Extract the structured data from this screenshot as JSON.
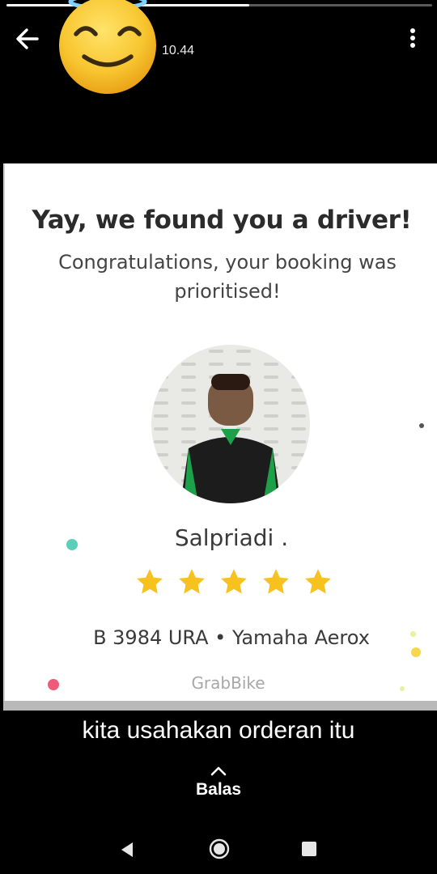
{
  "status": {
    "progress": 0.57,
    "timestamp": "10.44"
  },
  "header": {
    "back_icon": "arrow-left-icon",
    "avatar": "smiling-face-with-halo-emoji",
    "menu_icon": "more-vertical-icon"
  },
  "card": {
    "headline": "Yay, we found you a driver!",
    "subline": "Congratulations, your booking was prioritised!",
    "driver_name": "Salpriadi .",
    "rating_stars": 5,
    "vehicle": "B 3984 URA • Yamaha Aerox",
    "service": "GrabBike",
    "colors": {
      "star": "#f7c21e",
      "brand_green": "#1ca04a",
      "text": "#2b2b2b"
    }
  },
  "caption": "kita usahakan orderan itu",
  "reply": {
    "label": "Balas",
    "icon": "chevron-up-icon"
  },
  "navbar": {
    "back_icon": "nav-back-icon",
    "home_icon": "nav-home-icon",
    "recents_icon": "nav-recents-icon"
  }
}
